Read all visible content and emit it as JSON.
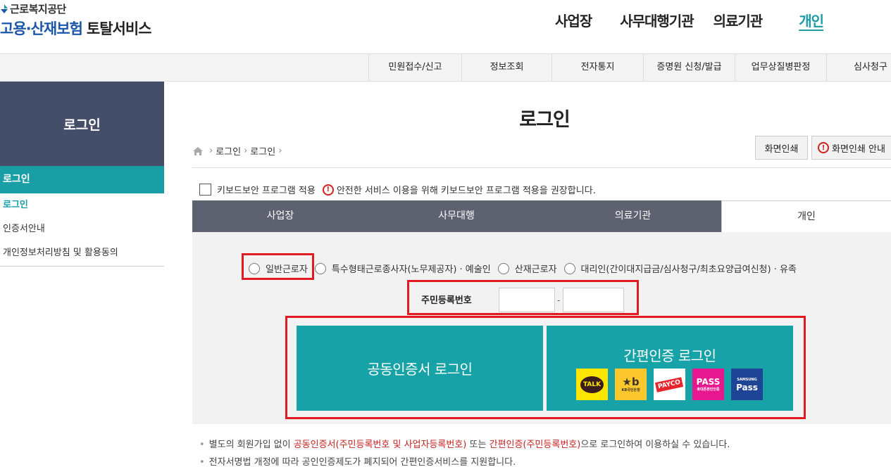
{
  "header": {
    "logo_top": "근로복지공단",
    "logo_blue": "고용·산재보험",
    "logo_dark": "토탈서비스",
    "nav": [
      "사업장",
      "사무대행기관",
      "의료기관",
      "개인"
    ]
  },
  "subnav": [
    "민원접수/신고",
    "정보조회",
    "전자통지",
    "증명원 신청/발급",
    "업무상질병판정",
    "심사청구"
  ],
  "sidebar": {
    "title": "로그인",
    "active": "로그인",
    "items": [
      "로그인",
      "인증서안내",
      "개인정보처리방침 및 활용동의"
    ]
  },
  "page": {
    "title": "로그인",
    "breadcrumb": [
      "로그인",
      "로그인"
    ],
    "print_label": "화면인쇄",
    "print_guide_label": "화면인쇄 안내"
  },
  "keyboard": {
    "checkbox_label": "키보드보안 프로그램 적용",
    "notice": "안전한 서비스 이용을 위해 키보드보안 프로그램 적용을 권장합니다.",
    "checked": false
  },
  "tabs": [
    "사업장",
    "사무대행",
    "의료기관",
    "개인"
  ],
  "active_tab": "개인",
  "user_types": [
    "일반근로자",
    "특수형태근로종사자(노무제공자) · 예술인",
    "산재근로자",
    "대리인(간이대지급금/심사청구/최초요양급여신청) · 유족"
  ],
  "ssn": {
    "label": "주민등록번호",
    "first_value": "",
    "second_value": "",
    "dash": "-"
  },
  "buttons": {
    "cert_login": "공동인증서 로그인",
    "easy_login": "간편인증 로그인"
  },
  "easy_apps": [
    {
      "name": "kakao-talk-icon",
      "text": "TALK",
      "color": "#fee500"
    },
    {
      "name": "kb-bank-icon",
      "text": "KB",
      "sub": "KB국민은행",
      "color": "#fcc82d"
    },
    {
      "name": "payco-icon",
      "text": "PAYCO",
      "color": "#ffffff"
    },
    {
      "name": "pass-icon",
      "text": "PASS",
      "sub": "휴대폰본인인증",
      "color": "#e7178f"
    },
    {
      "name": "samsung-pass-icon",
      "text": "Pass",
      "sub": "SAMSUNG",
      "color": "#1e4495"
    }
  ],
  "notes": {
    "line1": {
      "a": "별도의 회원가입 없이 ",
      "b": "공동인증서(주민등록번호 및 사업자등록번호)",
      "c": " 또는 ",
      "d": "간편인증(주민등록번호)",
      "e": "으로 로그인하여 이용하실 수 있습니다."
    },
    "line2": "전자서명법 개정에 따라 공인인증제도가 폐지되어 간편인증서비스를 지원합니다."
  }
}
